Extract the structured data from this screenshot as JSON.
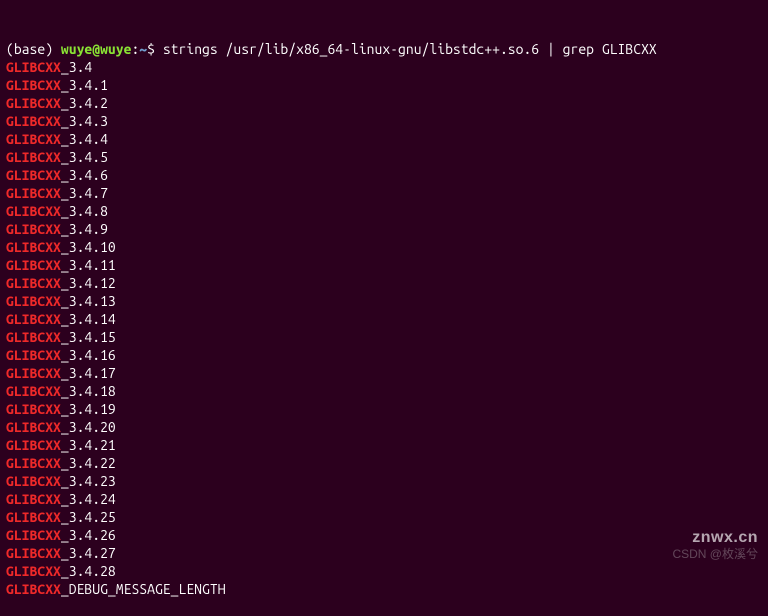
{
  "prompt": {
    "env": "(base) ",
    "user_host": "wuye@wuye",
    "colon": ":",
    "path": "~",
    "dollar": "$ ",
    "command": "strings /usr/lib/x86_64-linux-gnu/libstdc++.so.6 | grep GLIBCXX"
  },
  "highlight_term": "GLIBCXX",
  "output_lines": [
    "_3.4",
    "_3.4.1",
    "_3.4.2",
    "_3.4.3",
    "_3.4.4",
    "_3.4.5",
    "_3.4.6",
    "_3.4.7",
    "_3.4.8",
    "_3.4.9",
    "_3.4.10",
    "_3.4.11",
    "_3.4.12",
    "_3.4.13",
    "_3.4.14",
    "_3.4.15",
    "_3.4.16",
    "_3.4.17",
    "_3.4.18",
    "_3.4.19",
    "_3.4.20",
    "_3.4.21",
    "_3.4.22",
    "_3.4.23",
    "_3.4.24",
    "_3.4.25",
    "_3.4.26",
    "_3.4.27",
    "_3.4.28",
    "_DEBUG_MESSAGE_LENGTH"
  ],
  "watermarks": {
    "primary": "znwx.cn",
    "secondary": "CSDN @枚溪兮"
  }
}
